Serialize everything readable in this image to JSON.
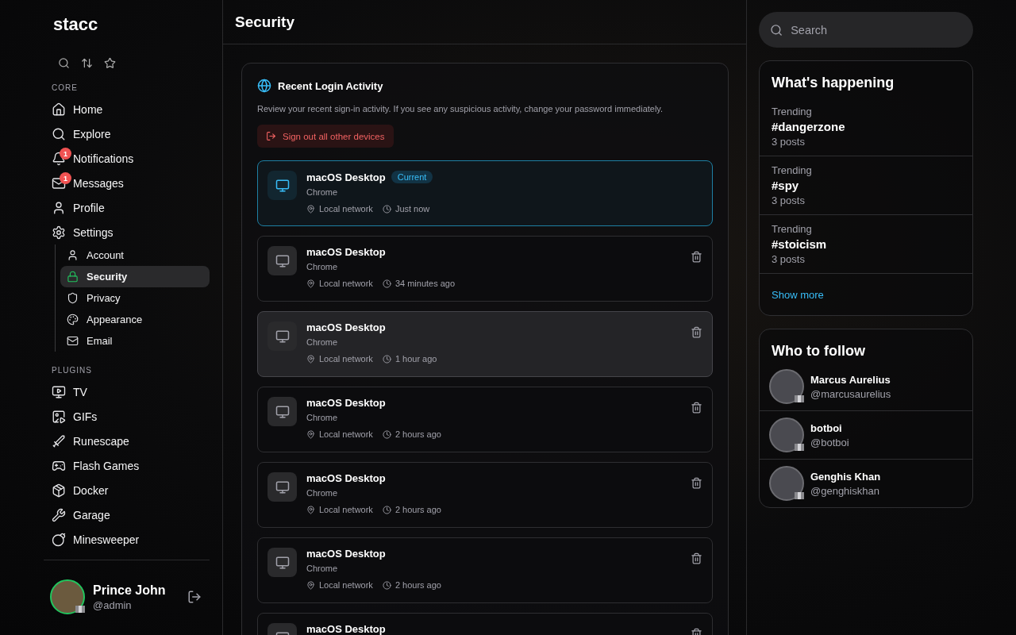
{
  "brand": "stacc",
  "sidebar": {
    "sections": [
      {
        "heading": "CORE",
        "items": [
          {
            "kind": "home",
            "label": "Home",
            "selected": false
          },
          {
            "kind": "explore",
            "label": "Explore",
            "selected": false
          },
          {
            "kind": "notifications",
            "label": "Notifications",
            "badge": "1",
            "selected": false
          },
          {
            "kind": "messages",
            "label": "Messages",
            "badge": "1",
            "selected": false
          },
          {
            "kind": "profile",
            "label": "Profile",
            "selected": false
          },
          {
            "kind": "settings",
            "label": "Settings",
            "selected": false,
            "children": [
              {
                "kind": "account",
                "label": "Account",
                "selected": false
              },
              {
                "kind": "security",
                "label": "Security",
                "selected": true
              },
              {
                "kind": "privacy",
                "label": "Privacy",
                "selected": false
              },
              {
                "kind": "appearance",
                "label": "Appearance",
                "selected": false
              },
              {
                "kind": "email",
                "label": "Email",
                "selected": false
              }
            ]
          }
        ]
      },
      {
        "heading": "PLUGINS",
        "items": [
          {
            "kind": "tv",
            "label": "TV",
            "selected": false
          },
          {
            "kind": "gifs",
            "label": "GIFs",
            "selected": false
          },
          {
            "kind": "runescape",
            "label": "Runescape",
            "selected": false
          },
          {
            "kind": "flash",
            "label": "Flash Games",
            "selected": false
          },
          {
            "kind": "docker",
            "label": "Docker",
            "selected": false
          },
          {
            "kind": "garage",
            "label": "Garage",
            "selected": false
          },
          {
            "kind": "minesweeper",
            "label": "Minesweeper",
            "selected": false
          }
        ]
      }
    ],
    "user": {
      "name": "Prince John",
      "handle": "@admin"
    }
  },
  "page_title": "Security",
  "login_activity": {
    "title": "Recent Login Activity",
    "description": "Review your recent sign-in activity. If you see any suspicious activity, change your password immediately.",
    "sign_out_button": "Sign out all other devices",
    "sessions": [
      {
        "device": "macOS Desktop",
        "badge": "Current",
        "current": true,
        "hovered": false,
        "browser": "Chrome",
        "location": "Local network",
        "time": "Just now"
      },
      {
        "device": "macOS Desktop",
        "current": false,
        "hovered": false,
        "browser": "Chrome",
        "location": "Local network",
        "time": "34 minutes ago"
      },
      {
        "device": "macOS Desktop",
        "current": false,
        "hovered": true,
        "browser": "Chrome",
        "location": "Local network",
        "time": "1 hour ago"
      },
      {
        "device": "macOS Desktop",
        "current": false,
        "hovered": false,
        "browser": "Chrome",
        "location": "Local network",
        "time": "2 hours ago"
      },
      {
        "device": "macOS Desktop",
        "current": false,
        "hovered": false,
        "browser": "Chrome",
        "location": "Local network",
        "time": "2 hours ago"
      },
      {
        "device": "macOS Desktop",
        "current": false,
        "hovered": false,
        "browser": "Chrome",
        "location": "Local network",
        "time": "2 hours ago"
      },
      {
        "device": "macOS Desktop",
        "current": false,
        "hovered": false
      }
    ]
  },
  "search": {
    "placeholder": "Search"
  },
  "whats_happening": {
    "title": "What's happening",
    "trends": [
      {
        "label": "Trending",
        "tag": "#dangerzone",
        "count": "3 posts"
      },
      {
        "label": "Trending",
        "tag": "#spy",
        "count": "3 posts"
      },
      {
        "label": "Trending",
        "tag": "#stoicism",
        "count": "3 posts"
      }
    ],
    "show_more": "Show more"
  },
  "who_to_follow": {
    "title": "Who to follow",
    "users": [
      {
        "name": "Marcus Aurelius",
        "handle": "@marcusaurelius"
      },
      {
        "name": "botboi",
        "handle": "@botboi"
      },
      {
        "name": "Genghis Khan",
        "handle": "@genghiskhan"
      }
    ]
  }
}
